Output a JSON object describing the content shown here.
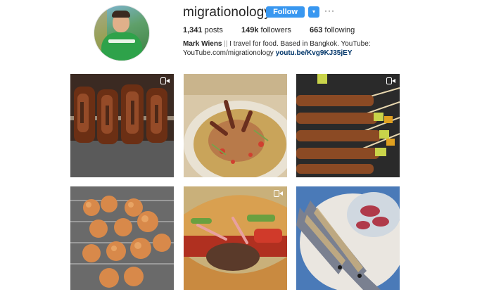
{
  "profile": {
    "username": "migrationology",
    "follow_label": "Follow",
    "dropdown_glyph": "▾",
    "more_glyph": "···",
    "stats": {
      "posts_count": "1,341",
      "posts_label": "posts",
      "followers_count": "149k",
      "followers_label": "followers",
      "following_count": "663",
      "following_label": "following"
    },
    "bio": {
      "name": "Mark Wiens",
      "separator": "||",
      "text": "I travel for food. Based in Bangkok. YouTube:",
      "url_text": "YouTube.com/migrationology",
      "link": "youtu.be/Kvg9KJ35jEY"
    }
  },
  "colors": {
    "accent": "#3897f0",
    "link": "#003569",
    "text": "#262626"
  },
  "posts": [
    {
      "subject": "grilled meat skewers",
      "video": true
    },
    {
      "subject": "crab papaya salad",
      "video": false
    },
    {
      "subject": "grilled satay skewers",
      "video": true
    },
    {
      "subject": "grilled meatball skewers",
      "video": false
    },
    {
      "subject": "burger with vegetables",
      "video": true
    },
    {
      "subject": "grilled mackerel with salad",
      "video": false
    }
  ]
}
